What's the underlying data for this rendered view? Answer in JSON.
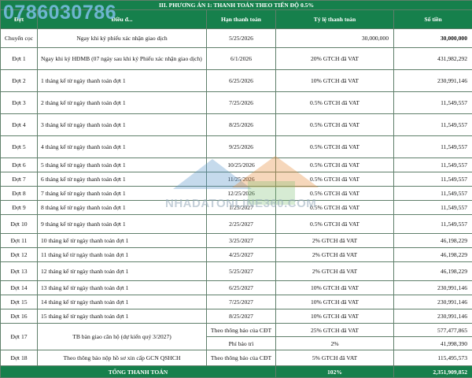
{
  "title": "III. PHƯƠNG ÁN 1: THANH TOÁN THEO TIẾN ĐỘ 0.5%",
  "watermark": {
    "phone": "0786030786",
    "site": "NHADATONLINE360.COM"
  },
  "headers": {
    "period": "Đợt",
    "desc": "Điều đ...",
    "due": "Hạn thanh toán",
    "rate": "Tỷ lệ thanh toán",
    "amount": "Số tiền"
  },
  "rows": [
    {
      "period": "Chuyển cọc",
      "desc": "Ngay khi ký phiếu xác nhận giao dịch",
      "due": "5/25/2026",
      "rate": "30,000,000",
      "amount": "30,000,000"
    },
    {
      "period": "Đợt 1",
      "desc": "Ngay khi ký HĐMB (07 ngày sau khi ký Phiếu xác nhận giao dịch)",
      "due": "6/1/2026",
      "rate": "20% GTCH đã VAT",
      "amount": "431,982,292"
    },
    {
      "period": "Đợt 2",
      "desc": "1 tháng kể từ ngày thanh toán đợt 1",
      "due": "6/25/2026",
      "rate": "10% GTCH đã VAT",
      "amount": "230,991,146"
    },
    {
      "period": "Đợt 3",
      "desc": "2 tháng kể từ ngày thanh toán đợt 1",
      "due": "7/25/2026",
      "rate": "0.5% GTCH đã VAT",
      "amount": "11,549,557"
    },
    {
      "period": "Đợt 4",
      "desc": "3 tháng kể từ ngày thanh toán đợt 1",
      "due": "8/25/2026",
      "rate": "0.5% GTCH đã VAT",
      "amount": "11,549,557"
    },
    {
      "period": "Đợt 5",
      "desc": "4 tháng kể từ ngày thanh toán đợt 1",
      "due": "9/25/2026",
      "rate": "0.5% GTCH đã VAT",
      "amount": "11,549,557"
    },
    {
      "period": "Đợt 6",
      "desc": "5 tháng kể từ ngày thanh toán đợt 1",
      "due": "10/25/2026",
      "rate": "0.5% GTCH đã VAT",
      "amount": "11,549,557"
    },
    {
      "period": "Đợt 7",
      "desc": "6 tháng kể từ ngày thanh toán đợt 1",
      "due": "11/25/2026",
      "rate": "0.5% GTCH đã VAT",
      "amount": "11,549,557"
    },
    {
      "period": "Đợt 8",
      "desc": "7 tháng kể từ ngày thanh toán đợt 1",
      "due": "12/25/2026",
      "rate": "0.5% GTCH đã VAT",
      "amount": "11,549,557"
    },
    {
      "period": "Đợt 9",
      "desc": "8 tháng kể từ ngày thanh toán đợt 1",
      "due": "1/25/2027",
      "rate": "0.5% GTCH đã VAT",
      "amount": "11,549,557"
    },
    {
      "period": "Đợt 10",
      "desc": "9 tháng kể từ ngày thanh toán đợt 1",
      "due": "2/25/2027",
      "rate": "0.5% GTCH đã VAT",
      "amount": "11,549,557"
    },
    {
      "period": "Đợt 11",
      "desc": "10 tháng kể từ ngày thanh toán đợt 1",
      "due": "3/25/2027",
      "rate": "2% GTCH đã VAT",
      "amount": "46,198,229"
    },
    {
      "period": "Đợt 12",
      "desc": "11 tháng kể từ ngày thanh toán đợt 1",
      "due": "4/25/2027",
      "rate": "2% GTCH đã VAT",
      "amount": "46,198,229"
    },
    {
      "period": "Đợt 13",
      "desc": "12 tháng kể từ ngày thanh toán đợt 1",
      "due": "5/25/2027",
      "rate": "2% GTCH đã VAT",
      "amount": "46,198,229"
    },
    {
      "period": "Đợt 14",
      "desc": "13 tháng kể từ ngày thanh toán đợt 1",
      "due": "6/25/2027",
      "rate": "10% GTCH đã VAT",
      "amount": "230,991,146"
    },
    {
      "period": "Đợt 15",
      "desc": "14 tháng kể từ ngày thanh toán đợt 1",
      "due": "7/25/2027",
      "rate": "10% GTCH đã VAT",
      "amount": "230,991,146"
    },
    {
      "period": "Đợt 16",
      "desc": "15 tháng kể từ ngày thanh toán đợt 1",
      "due": "8/25/2027",
      "rate": "10% GTCH đã VAT",
      "amount": "230,991,146"
    }
  ],
  "row17": {
    "period": "Đợt 17",
    "desc": "TB bàn giao căn hộ (dự kiến quý 3/2027)",
    "due": "Theo thông báo của CĐT",
    "rate": "25% GTCH đã VAT",
    "amount": "577,477,865",
    "fee_due": "Phí bảo trì",
    "fee_rate": "2%",
    "fee_amount": "41,998,390"
  },
  "row18": {
    "period": "Đợt 18",
    "desc": "Theo thông báo nộp hồ sơ xin cấp GCN QSHCH",
    "due": "Theo thông báo của CĐT",
    "rate": "5% GTCH đã VAT",
    "amount": "115,495,573"
  },
  "total": {
    "label": "TỔNG THANH TOÁN",
    "rate": "102%",
    "amount": "2,351,909,852"
  }
}
